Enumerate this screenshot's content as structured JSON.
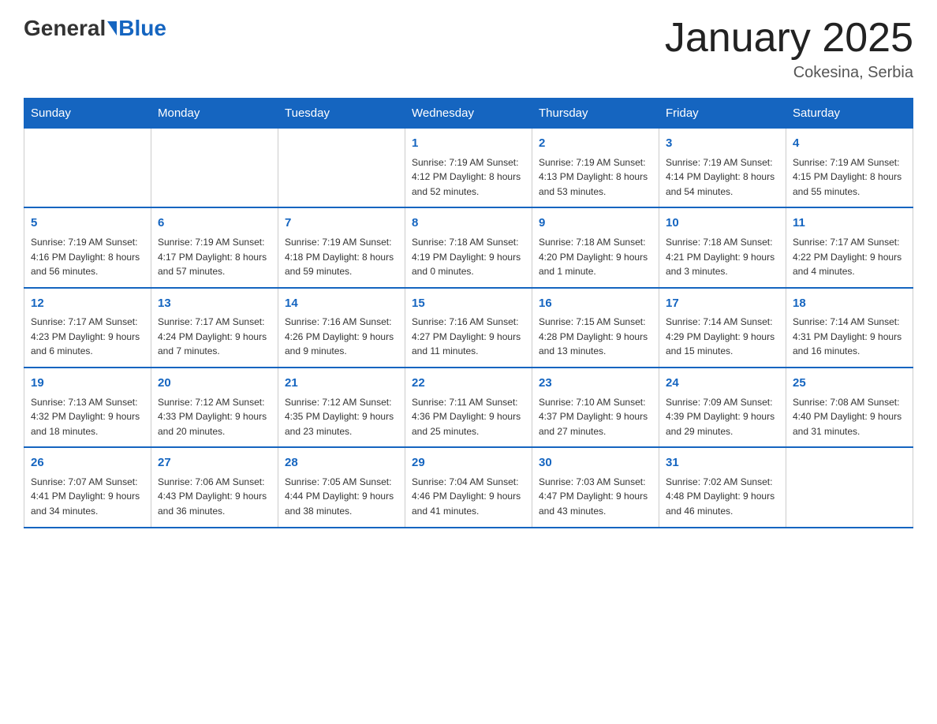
{
  "header": {
    "logo_general": "General",
    "logo_blue": "Blue",
    "title": "January 2025",
    "subtitle": "Cokesina, Serbia"
  },
  "calendar": {
    "days_of_week": [
      "Sunday",
      "Monday",
      "Tuesday",
      "Wednesday",
      "Thursday",
      "Friday",
      "Saturday"
    ],
    "weeks": [
      [
        {
          "day": "",
          "info": ""
        },
        {
          "day": "",
          "info": ""
        },
        {
          "day": "",
          "info": ""
        },
        {
          "day": "1",
          "info": "Sunrise: 7:19 AM\nSunset: 4:12 PM\nDaylight: 8 hours\nand 52 minutes."
        },
        {
          "day": "2",
          "info": "Sunrise: 7:19 AM\nSunset: 4:13 PM\nDaylight: 8 hours\nand 53 minutes."
        },
        {
          "day": "3",
          "info": "Sunrise: 7:19 AM\nSunset: 4:14 PM\nDaylight: 8 hours\nand 54 minutes."
        },
        {
          "day": "4",
          "info": "Sunrise: 7:19 AM\nSunset: 4:15 PM\nDaylight: 8 hours\nand 55 minutes."
        }
      ],
      [
        {
          "day": "5",
          "info": "Sunrise: 7:19 AM\nSunset: 4:16 PM\nDaylight: 8 hours\nand 56 minutes."
        },
        {
          "day": "6",
          "info": "Sunrise: 7:19 AM\nSunset: 4:17 PM\nDaylight: 8 hours\nand 57 minutes."
        },
        {
          "day": "7",
          "info": "Sunrise: 7:19 AM\nSunset: 4:18 PM\nDaylight: 8 hours\nand 59 minutes."
        },
        {
          "day": "8",
          "info": "Sunrise: 7:18 AM\nSunset: 4:19 PM\nDaylight: 9 hours\nand 0 minutes."
        },
        {
          "day": "9",
          "info": "Sunrise: 7:18 AM\nSunset: 4:20 PM\nDaylight: 9 hours\nand 1 minute."
        },
        {
          "day": "10",
          "info": "Sunrise: 7:18 AM\nSunset: 4:21 PM\nDaylight: 9 hours\nand 3 minutes."
        },
        {
          "day": "11",
          "info": "Sunrise: 7:17 AM\nSunset: 4:22 PM\nDaylight: 9 hours\nand 4 minutes."
        }
      ],
      [
        {
          "day": "12",
          "info": "Sunrise: 7:17 AM\nSunset: 4:23 PM\nDaylight: 9 hours\nand 6 minutes."
        },
        {
          "day": "13",
          "info": "Sunrise: 7:17 AM\nSunset: 4:24 PM\nDaylight: 9 hours\nand 7 minutes."
        },
        {
          "day": "14",
          "info": "Sunrise: 7:16 AM\nSunset: 4:26 PM\nDaylight: 9 hours\nand 9 minutes."
        },
        {
          "day": "15",
          "info": "Sunrise: 7:16 AM\nSunset: 4:27 PM\nDaylight: 9 hours\nand 11 minutes."
        },
        {
          "day": "16",
          "info": "Sunrise: 7:15 AM\nSunset: 4:28 PM\nDaylight: 9 hours\nand 13 minutes."
        },
        {
          "day": "17",
          "info": "Sunrise: 7:14 AM\nSunset: 4:29 PM\nDaylight: 9 hours\nand 15 minutes."
        },
        {
          "day": "18",
          "info": "Sunrise: 7:14 AM\nSunset: 4:31 PM\nDaylight: 9 hours\nand 16 minutes."
        }
      ],
      [
        {
          "day": "19",
          "info": "Sunrise: 7:13 AM\nSunset: 4:32 PM\nDaylight: 9 hours\nand 18 minutes."
        },
        {
          "day": "20",
          "info": "Sunrise: 7:12 AM\nSunset: 4:33 PM\nDaylight: 9 hours\nand 20 minutes."
        },
        {
          "day": "21",
          "info": "Sunrise: 7:12 AM\nSunset: 4:35 PM\nDaylight: 9 hours\nand 23 minutes."
        },
        {
          "day": "22",
          "info": "Sunrise: 7:11 AM\nSunset: 4:36 PM\nDaylight: 9 hours\nand 25 minutes."
        },
        {
          "day": "23",
          "info": "Sunrise: 7:10 AM\nSunset: 4:37 PM\nDaylight: 9 hours\nand 27 minutes."
        },
        {
          "day": "24",
          "info": "Sunrise: 7:09 AM\nSunset: 4:39 PM\nDaylight: 9 hours\nand 29 minutes."
        },
        {
          "day": "25",
          "info": "Sunrise: 7:08 AM\nSunset: 4:40 PM\nDaylight: 9 hours\nand 31 minutes."
        }
      ],
      [
        {
          "day": "26",
          "info": "Sunrise: 7:07 AM\nSunset: 4:41 PM\nDaylight: 9 hours\nand 34 minutes."
        },
        {
          "day": "27",
          "info": "Sunrise: 7:06 AM\nSunset: 4:43 PM\nDaylight: 9 hours\nand 36 minutes."
        },
        {
          "day": "28",
          "info": "Sunrise: 7:05 AM\nSunset: 4:44 PM\nDaylight: 9 hours\nand 38 minutes."
        },
        {
          "day": "29",
          "info": "Sunrise: 7:04 AM\nSunset: 4:46 PM\nDaylight: 9 hours\nand 41 minutes."
        },
        {
          "day": "30",
          "info": "Sunrise: 7:03 AM\nSunset: 4:47 PM\nDaylight: 9 hours\nand 43 minutes."
        },
        {
          "day": "31",
          "info": "Sunrise: 7:02 AM\nSunset: 4:48 PM\nDaylight: 9 hours\nand 46 minutes."
        },
        {
          "day": "",
          "info": ""
        }
      ]
    ]
  }
}
